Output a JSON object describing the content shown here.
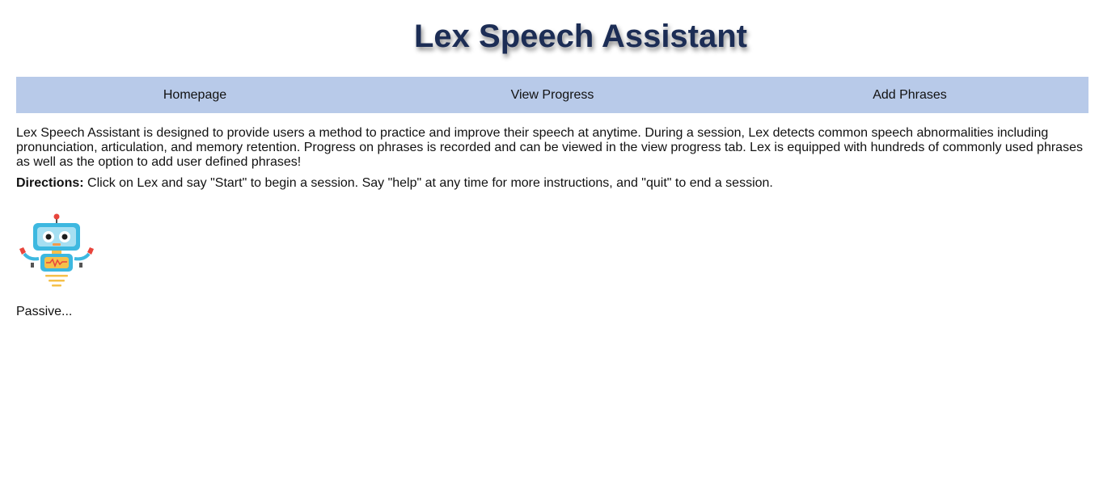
{
  "header": {
    "title": "Lex Speech Assistant"
  },
  "nav": {
    "items": [
      {
        "label": "Homepage"
      },
      {
        "label": "View Progress"
      },
      {
        "label": "Add Phrases"
      }
    ]
  },
  "main": {
    "intro": "Lex Speech Assistant is designed to provide users a method to practice and improve their speech at anytime. During a session, Lex detects common speech abnormalities including pronunciation, articulation, and memory retention. Progress on phrases is recorded and can be viewed in the view progress tab. Lex is equipped with hundreds of commonly used phrases as well as the option to add user defined phrases!",
    "directions_label": "Directions:",
    "directions_text": " Click on Lex and say \"Start\" to begin a session. Say \"help\" at any time for more instructions, and \"quit\" to end a session.",
    "status": "Passive..."
  },
  "colors": {
    "title": "#1c2d55",
    "nav_background": "#b8cae9",
    "robot_body": "#3db8e0",
    "robot_accent": "#e8453c"
  },
  "icons": {
    "robot": "robot-icon"
  }
}
